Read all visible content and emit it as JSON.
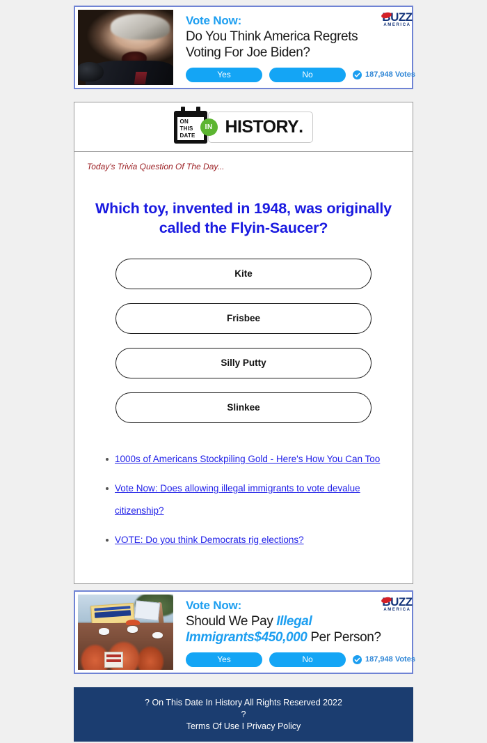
{
  "page": {
    "background": "#f0f0f0",
    "card_background": "#ffffff",
    "accent_blue": "#1c9ef0",
    "question_blue": "#1a1ae0",
    "link_blue": "#2020e8",
    "footer_navy": "#1b3d70",
    "kicker_red": "#9c2024",
    "green": "#5cb531"
  },
  "top_ad": {
    "kicker": "Vote Now:",
    "headline_line1": "Do You Think America Regrets",
    "headline_line2": "Voting For Joe Biden?",
    "yes_label": "Yes",
    "no_label": "No",
    "votes": "187,948 Votes",
    "logo_word": "BUZZ",
    "logo_sub": "AMERICA",
    "image_alt": "joe-biden-shouting-photo"
  },
  "brand": {
    "calendar_line1": "ON",
    "calendar_line2": "THIS",
    "calendar_line3": "DATE",
    "in_label": "IN",
    "history_label": "HISTORY",
    "history_dot": "."
  },
  "trivia": {
    "kicker": "Today's Trivia Question Of The Day...",
    "question": "Which toy, invented in 1948, was originally called the Flyin-Saucer?",
    "answers": [
      {
        "label": "Kite"
      },
      {
        "label": "Frisbee"
      },
      {
        "label": "Silly Putty"
      },
      {
        "label": "Slinkee"
      }
    ]
  },
  "links": [
    {
      "label": "1000s of Americans Stockpiling Gold - Here's How You Can Too"
    },
    {
      "label": "Vote Now: Does allowing illegal immigrants to vote devalue citizenship?"
    },
    {
      "label": "VOTE: Do you think Democrats rig elections?"
    }
  ],
  "bottom_ad": {
    "kicker": "Vote Now:",
    "headline_part1": "Should We Pay ",
    "headline_highlight1": "Illegal Immigrants",
    "headline_highlight2": "$450,000",
    "headline_part2": " Per Person?",
    "yes_label": "Yes",
    "no_label": "No",
    "votes": "187,948 Votes",
    "logo_word": "BUZZ",
    "logo_sub": "AMERICA",
    "image_alt": "citizenship-now-protest-photo"
  },
  "footer": {
    "line1": "? On This Date In History All Rights Reserved 2022",
    "line2": "?",
    "line3_terms": "Terms Of Use",
    "line3_sep": " I ",
    "line3_privacy": "Privacy Policy"
  }
}
